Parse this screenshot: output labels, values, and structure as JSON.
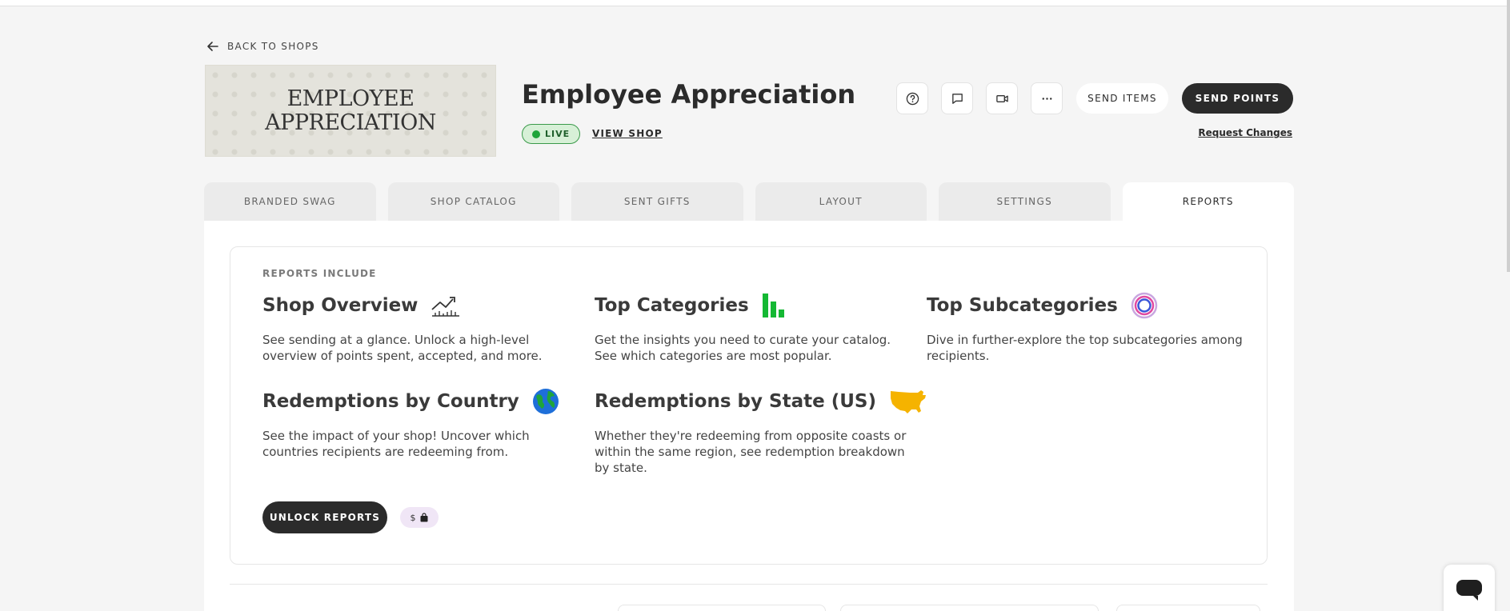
{
  "nav": {
    "back_label": "BACK TO SHOPS"
  },
  "shop": {
    "banner_line1": "EMPLOYEE",
    "banner_line2": "APPRECIATION",
    "title": "Employee Appreciation",
    "status": "LIVE",
    "view_shop_label": "VIEW SHOP"
  },
  "actions": {
    "icons": [
      "help-icon",
      "comment-icon",
      "video-icon",
      "more-icon"
    ],
    "send_items_label": "SEND ITEMS",
    "send_points_label": "SEND POINTS",
    "request_changes_label": "Request Changes"
  },
  "tabs": [
    {
      "label": "BRANDED SWAG",
      "active": false
    },
    {
      "label": "SHOP CATALOG",
      "active": false
    },
    {
      "label": "SENT GIFTS",
      "active": false
    },
    {
      "label": "LAYOUT",
      "active": false
    },
    {
      "label": "SETTINGS",
      "active": false
    },
    {
      "label": "REPORTS",
      "active": true
    }
  ],
  "reports": {
    "heading": "REPORTS INCLUDE",
    "features": [
      {
        "title": "Shop Overview",
        "icon": "line-chart-icon",
        "desc": "See sending at a glance. Unlock a high-level overview of points spent, accepted, and more."
      },
      {
        "title": "Top Categories",
        "icon": "bar-chart-icon",
        "desc": "Get the insights you need to curate your catalog. See which categories are most popular."
      },
      {
        "title": "Top Subcategories",
        "icon": "target-icon",
        "desc": "Dive in further-explore the top subcategories among recipients."
      },
      {
        "title": "Redemptions by Country",
        "icon": "globe-icon",
        "desc": "See the impact of your shop! Uncover which countries recipients are redeeming from."
      },
      {
        "title": "Redemptions by State (US)",
        "icon": "us-map-icon",
        "desc": "Whether they're redeeming from opposite coasts or within the same region, see redemption breakdown by state."
      }
    ],
    "unlock_label": "UNLOCK REPORTS",
    "price_symbol": "$"
  },
  "colors": {
    "accent_dark": "#2b2b2b",
    "live_green": "#1fa53a",
    "bar_green": "#14b833",
    "map_yellow": "#f5b300",
    "globe_blue": "#1e6fd9"
  }
}
